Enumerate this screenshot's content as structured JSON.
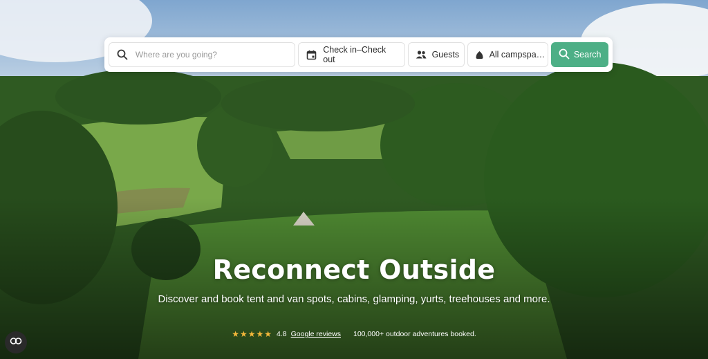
{
  "search": {
    "where_placeholder": "Where are you going?",
    "dates_label": "Check in–Check out",
    "guests_label": "Guests",
    "type_label": "All campspa…",
    "button_label": "Search"
  },
  "hero": {
    "title": "Reconnect Outside",
    "subtitle": "Discover and book tent and van spots, cabins, glamping, yurts, treehouses and more."
  },
  "reviews": {
    "stars": "★★★★★",
    "rating": "4.8",
    "source_link": "Google reviews",
    "bookings": "100,000+ outdoor adventures booked."
  },
  "colors": {
    "search_button": "#4daf86",
    "star": "#f6b93b"
  },
  "icons": [
    "search-icon",
    "calendar-icon",
    "guests-icon",
    "campsite-type-icon",
    "chat-icon"
  ]
}
